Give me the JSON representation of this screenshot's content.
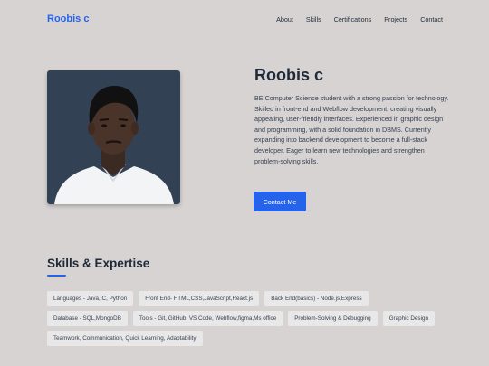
{
  "nav": {
    "brand": "Roobis c",
    "links": [
      "About",
      "Skills",
      "Certifications",
      "Projects",
      "Contact"
    ]
  },
  "hero": {
    "name": "Roobis c",
    "bio": "BE Computer Science student with a strong passion for technology. Skilled in front-end and Webflow development, creating visually appealing, user-friendly interfaces. Experienced in graphic design and programming, with a solid foundation in DBMS. Currently expanding into backend development to become a full-stack developer. Eager to learn new technologies and strengthen problem-solving skills.",
    "button": "Contact Me"
  },
  "skills": {
    "title": "Skills & Expertise",
    "items": [
      "Languages - Java, C, Python",
      "Front End- HTML,CSS,JavaScript,React.js",
      "Back End(basics) - Node.js,Express",
      "Database - SQL,MongoDB",
      "Tools - Git, GitHub, VS Code, Webflow,figma,Ms office",
      "Problem-Solving & Debugging",
      "Graphic Design",
      "Teamwork, Communication, Quick Learning, Adaptability"
    ]
  },
  "colors": {
    "accent": "#2563eb",
    "background": "#d6d3d2",
    "photo_bg": "#334155"
  }
}
